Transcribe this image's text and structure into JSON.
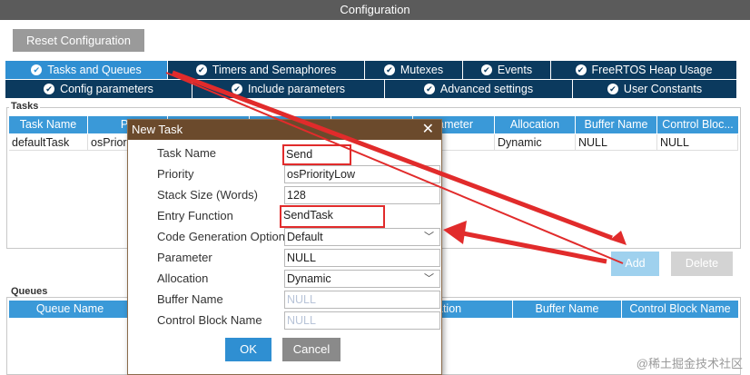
{
  "window": {
    "title": "Configuration"
  },
  "toolbar": {
    "reset_label": "Reset Configuration"
  },
  "tabs_row1": [
    {
      "label": "Tasks and Queues",
      "active": true
    },
    {
      "label": "Timers and Semaphores",
      "active": false
    },
    {
      "label": "Mutexes",
      "active": false
    },
    {
      "label": "Events",
      "active": false
    },
    {
      "label": "FreeRTOS Heap Usage",
      "active": false
    }
  ],
  "tabs_row2": [
    {
      "label": "Config parameters"
    },
    {
      "label": "Include parameters"
    },
    {
      "label": "Advanced settings"
    },
    {
      "label": "User Constants"
    }
  ],
  "tasks": {
    "group_label": "Tasks",
    "headers": [
      "Task Name",
      "Pri",
      "",
      "",
      "",
      "rameter",
      "Allocation",
      "Buffer Name",
      "Control Bloc..."
    ],
    "row": [
      "defaultTask",
      "osPrior",
      "",
      "",
      "",
      "-",
      "Dynamic",
      "NULL",
      "NULL"
    ],
    "add_label": "Add",
    "delete_label": "Delete"
  },
  "queues": {
    "group_label": "Queues",
    "headers": [
      "Queue Name",
      "",
      "ation",
      "Buffer Name",
      "Control Block Name"
    ]
  },
  "dialog": {
    "title": "New Task",
    "close": "✕",
    "fields": [
      {
        "label": "Task Name",
        "value": "Send"
      },
      {
        "label": "Priority",
        "value": "osPriorityLow"
      },
      {
        "label": "Stack Size (Words)",
        "value": "128"
      },
      {
        "label": "Entry Function",
        "value": "SendTask"
      },
      {
        "label": "Code Generation Option",
        "value": "Default"
      },
      {
        "label": "Parameter",
        "value": "NULL"
      },
      {
        "label": "Allocation",
        "value": "Dynamic"
      },
      {
        "label": "Buffer Name",
        "value": "NULL"
      },
      {
        "label": "Control Block Name",
        "value": "NULL"
      }
    ],
    "ok_label": "OK",
    "cancel_label": "Cancel"
  },
  "watermark": "@稀土掘金技术社区",
  "colors": {
    "tab_bg": "#0b3a5e",
    "tab_active": "#2f8fd2",
    "header_blue": "#3a99d8",
    "dialog_title": "#6b4a2c",
    "annotation_red": "#e12b2b"
  }
}
